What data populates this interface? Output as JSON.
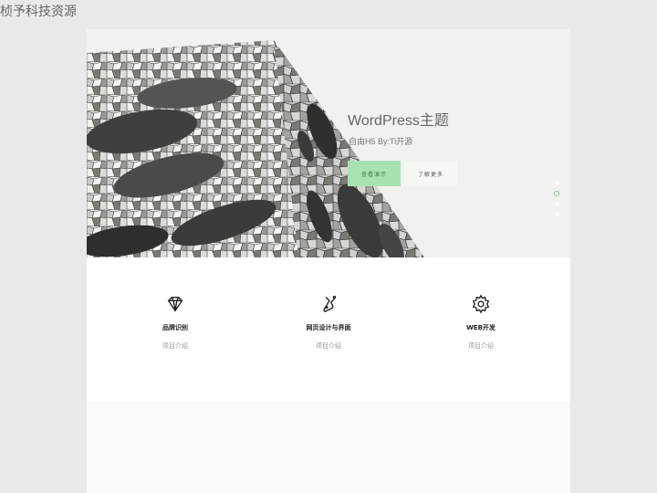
{
  "site": {
    "title": "桢予科技资源"
  },
  "hero": {
    "title": "WordPress主题",
    "subtitle": "自由H5 By:Ti开源",
    "primary_button": "查看演示",
    "secondary_button": "了解更多",
    "slides": 4,
    "active_slide": 2,
    "accent_color": "#a8e2b1"
  },
  "services": [
    {
      "icon": "diamond-icon",
      "title": "品牌识别",
      "desc": "项目介绍"
    },
    {
      "icon": "flask-icon",
      "title": "网页设计与界面",
      "desc": "项目介绍"
    },
    {
      "icon": "gear-icon",
      "title": "WEB开发",
      "desc": "项目介绍"
    }
  ]
}
